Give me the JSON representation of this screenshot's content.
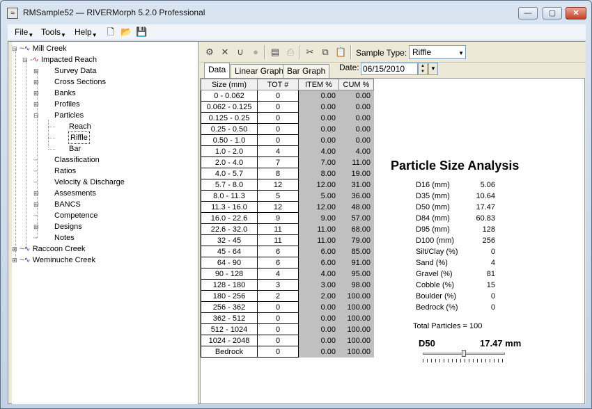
{
  "window": {
    "title": "RMSample52 — RIVERMorph 5.2.0 Professional",
    "min_glyph": "—",
    "max_glyph": "▢",
    "close_glyph": "✕"
  },
  "menu": {
    "items": [
      "File",
      "Tools",
      "Help"
    ]
  },
  "tree": {
    "root": "Mill Creek",
    "reach": "Impacted Reach",
    "children": [
      "Survey Data",
      "Cross Sections",
      "Banks",
      "Profiles",
      "Particles"
    ],
    "particle_children": [
      "Reach",
      "Riffle",
      "Bar"
    ],
    "after": [
      "Classification",
      "Ratios",
      "Velocity & Discharge",
      "Assesments",
      "BANCS",
      "Competence",
      "Designs",
      "Notes"
    ],
    "other_rivers": [
      "Raccoon Creek",
      "Weminuche Creek"
    ]
  },
  "toolbar": {
    "sample_type_label": "Sample Type:",
    "sample_type_value": "Riffle"
  },
  "tabs": [
    "Data",
    "Linear Graph",
    "Bar Graph"
  ],
  "date": {
    "label": "Date:",
    "value": "06/15/2010"
  },
  "table": {
    "headers": [
      "Size (mm)",
      "TOT #",
      "ITEM %",
      "CUM %"
    ],
    "rows": [
      [
        "0 - 0.062",
        "0",
        "0.00",
        "0.00"
      ],
      [
        "0.062 - 0.125",
        "0",
        "0.00",
        "0.00"
      ],
      [
        "0.125 - 0.25",
        "0",
        "0.00",
        "0.00"
      ],
      [
        "0.25 - 0.50",
        "0",
        "0.00",
        "0.00"
      ],
      [
        "0.50 - 1.0",
        "0",
        "0.00",
        "0.00"
      ],
      [
        "1.0 - 2.0",
        "4",
        "4.00",
        "4.00"
      ],
      [
        "2.0 - 4.0",
        "7",
        "7.00",
        "11.00"
      ],
      [
        "4.0 - 5.7",
        "8",
        "8.00",
        "19.00"
      ],
      [
        "5.7 - 8.0",
        "12",
        "12.00",
        "31.00"
      ],
      [
        "8.0 - 11.3",
        "5",
        "5.00",
        "36.00"
      ],
      [
        "11.3 - 16.0",
        "12",
        "12.00",
        "48.00"
      ],
      [
        "16.0 - 22.6",
        "9",
        "9.00",
        "57.00"
      ],
      [
        "22.6 - 32.0",
        "11",
        "11.00",
        "68.00"
      ],
      [
        "32 - 45",
        "11",
        "11.00",
        "79.00"
      ],
      [
        "45 - 64",
        "6",
        "6.00",
        "85.00"
      ],
      [
        "64 - 90",
        "6",
        "6.00",
        "91.00"
      ],
      [
        "90 - 128",
        "4",
        "4.00",
        "95.00"
      ],
      [
        "128 - 180",
        "3",
        "3.00",
        "98.00"
      ],
      [
        "180 - 256",
        "2",
        "2.00",
        "100.00"
      ],
      [
        "256 - 362",
        "0",
        "0.00",
        "100.00"
      ],
      [
        "362 - 512",
        "0",
        "0.00",
        "100.00"
      ],
      [
        "512 - 1024",
        "0",
        "0.00",
        "100.00"
      ],
      [
        "1024 - 2048",
        "0",
        "0.00",
        "100.00"
      ],
      [
        "Bedrock",
        "0",
        "0.00",
        "100.00"
      ]
    ]
  },
  "analysis": {
    "title": "Particle Size Analysis",
    "stats": [
      [
        "D16 (mm)",
        "5.06"
      ],
      [
        "D35 (mm)",
        "10.64"
      ],
      [
        "D50 (mm)",
        "17.47"
      ],
      [
        "D84 (mm)",
        "60.83"
      ],
      [
        "D95 (mm)",
        "128"
      ],
      [
        "D100 (mm)",
        "256"
      ],
      [
        "Silt/Clay (%)",
        "0"
      ],
      [
        "Sand (%)",
        "4"
      ],
      [
        "Gravel (%)",
        "81"
      ],
      [
        "Cobble (%)",
        "15"
      ],
      [
        "Boulder (%)",
        "0"
      ],
      [
        "Bedrock (%)",
        "0"
      ]
    ],
    "total": "Total Particles = 100",
    "d50_label": "D50",
    "d50_value": "17.47 mm",
    "slider_position": 0.5
  },
  "colors": {
    "gray_column": "#c0c0c0",
    "tree_icon": "#3944a8"
  }
}
